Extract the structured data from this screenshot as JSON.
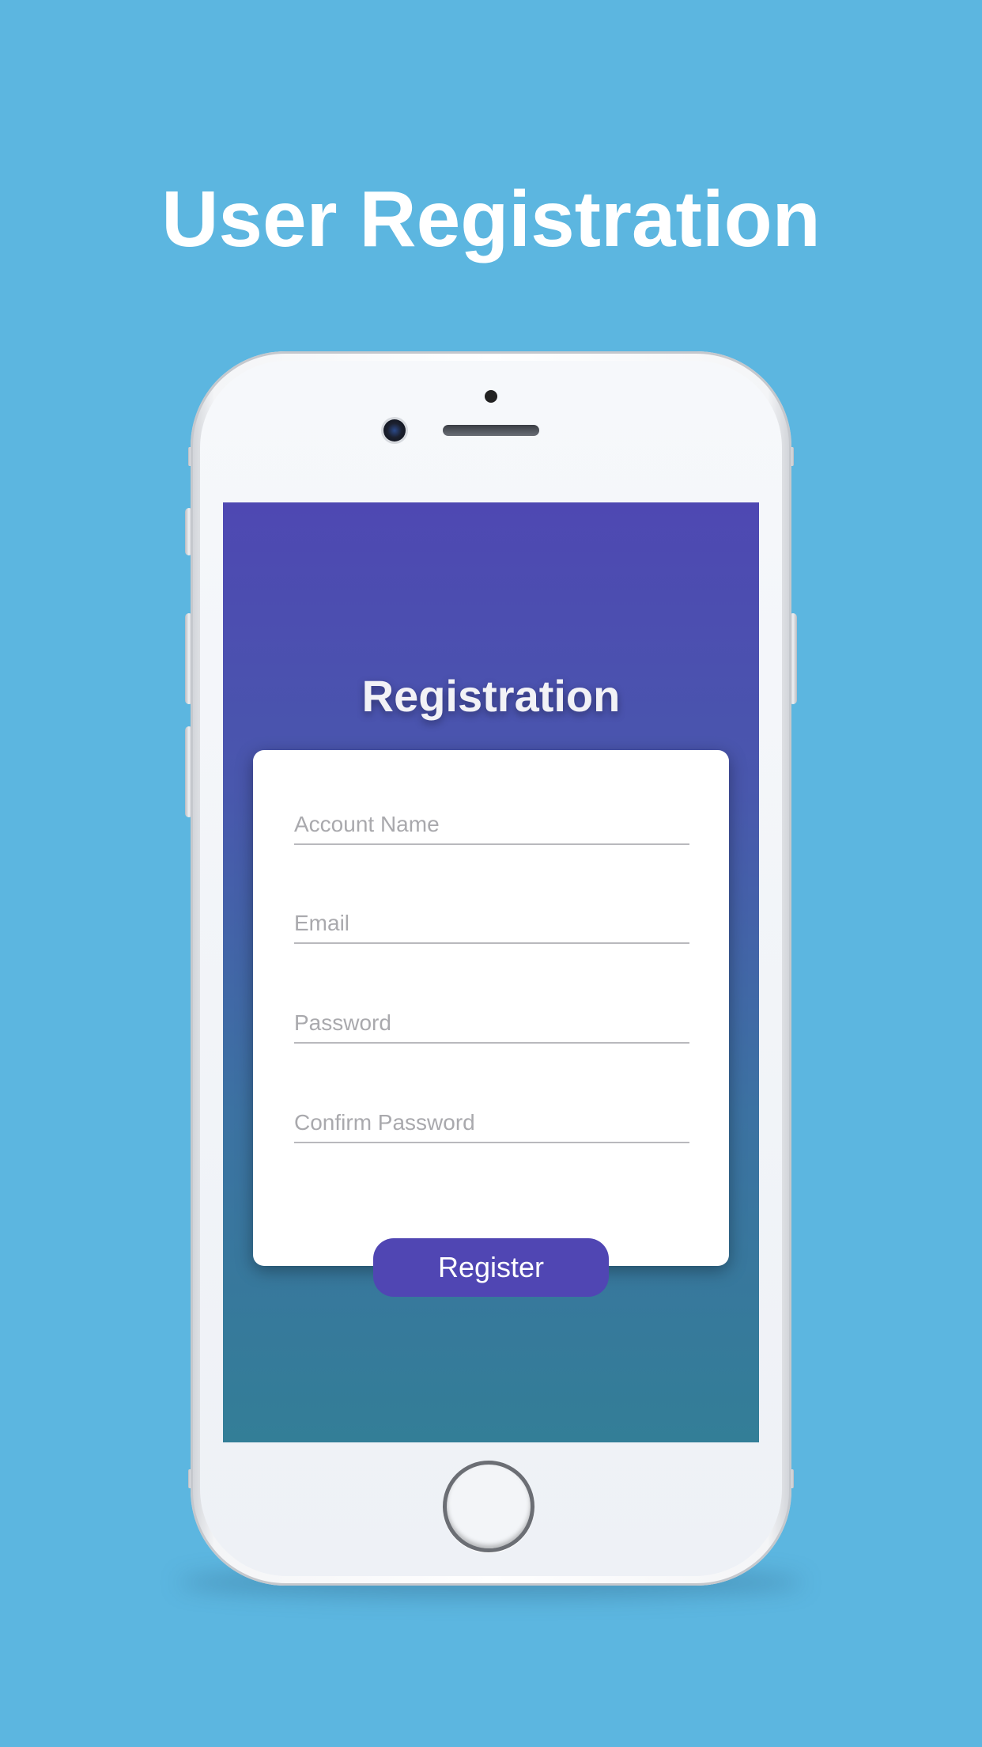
{
  "page": {
    "title": "User Registration",
    "background_color": "#5cb6e0"
  },
  "screen": {
    "title": "Registration",
    "gradient_top_color": "#4e48b2",
    "gradient_bottom_color": "#337e97"
  },
  "form": {
    "fields": [
      {
        "placeholder": "Account Name",
        "value": ""
      },
      {
        "placeholder": "Email",
        "value": ""
      },
      {
        "placeholder": "Password",
        "value": ""
      },
      {
        "placeholder": "Confirm Password",
        "value": ""
      }
    ],
    "submit_label": "Register",
    "submit_color": "#5046b3"
  }
}
